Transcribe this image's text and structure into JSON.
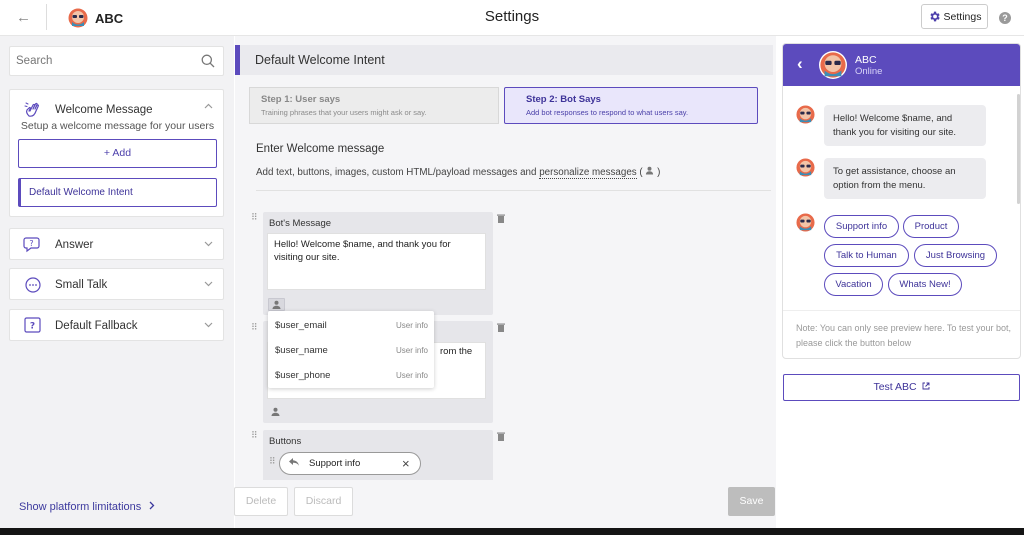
{
  "topbar": {
    "brand_name": "ABC",
    "page_title": "Settings",
    "settings_label": "Settings",
    "help_symbol": "?"
  },
  "sidebar": {
    "search_placeholder": "Search",
    "welcome": {
      "label": "Welcome Message",
      "description": "Setup a welcome message for your users",
      "add_label": "+ Add",
      "intent_label": "Default Welcome Intent"
    },
    "items": [
      {
        "label": "Answer",
        "icon": "chat-question-icon"
      },
      {
        "label": "Small Talk",
        "icon": "chat-bubble-icon"
      },
      {
        "label": "Default Fallback",
        "icon": "question-box-icon"
      }
    ],
    "platform_link": "Show platform limitations"
  },
  "editor": {
    "intent_title": "Default Welcome Intent",
    "step1": {
      "title": "Step 1: User says",
      "subtitle": "Training phrases that your users might ask or say."
    },
    "step2": {
      "title": "Step 2: Bot Says",
      "subtitle": "Add bot responses to respond to what users say."
    },
    "section_title": "Enter Welcome message",
    "section_desc": "Add text, buttons, images, custom HTML/payload messages and",
    "section_link": "personalize messages",
    "card1": {
      "title": "Bot's Message",
      "text": "Hello! Welcome $name, and thank you for visiting our site."
    },
    "card2": {
      "partial_text": "rom the"
    },
    "dropdown": [
      {
        "value": "$user_email",
        "tag": "User info"
      },
      {
        "value": "$user_name",
        "tag": "User info"
      },
      {
        "value": "$user_phone",
        "tag": "User info"
      }
    ],
    "card3": {
      "title": "Buttons",
      "button_label": "Support info"
    },
    "delete_label": "Delete",
    "discard_label": "Discard",
    "save_label": "Save"
  },
  "chat": {
    "name": "ABC",
    "status": "Online",
    "messages": [
      "Hello! Welcome $name, and thank you for visiting our site.",
      "To get assistance, choose an option from the menu."
    ],
    "quick_replies": [
      "Support info",
      "Product",
      "Talk to Human",
      "Just Browsing",
      "Vacation",
      "Whats New!"
    ],
    "note": "Note: You can only see preview here. To test your bot, please click the button below",
    "test_label": "Test ABC"
  },
  "colors": {
    "accent": "#5c4bbd",
    "accent_light": "#e9e6fb",
    "panel_bg": "#f2f2f4"
  }
}
